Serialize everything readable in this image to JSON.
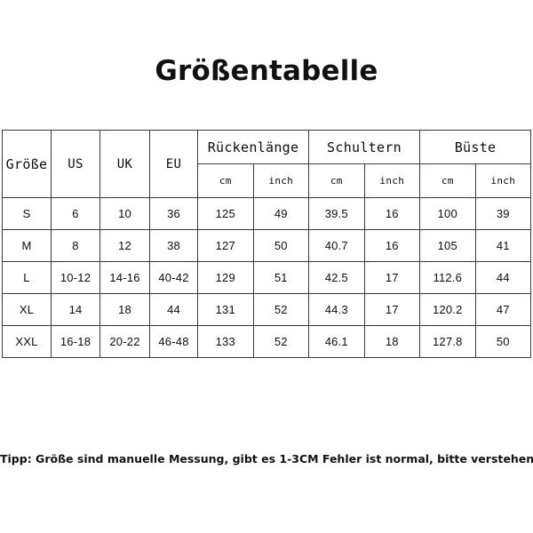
{
  "document": {
    "title": "Größentabelle",
    "note": "Tipp: Größe sind manuelle Messung, gibt es 1-3CM Fehler ist normal, bitte verstehen."
  },
  "table": {
    "headers": {
      "size": "Größe",
      "us": "US",
      "uk": "UK",
      "eu": "EU",
      "groups": [
        {
          "label": "Rückenlänge",
          "sub": [
            "cm",
            "inch"
          ]
        },
        {
          "label": "Schultern",
          "sub": [
            "cm",
            "inch"
          ]
        },
        {
          "label": "Büste",
          "sub": [
            "cm",
            "inch"
          ]
        }
      ]
    },
    "rows": [
      {
        "size": "S",
        "us": "6",
        "uk": "10",
        "eu": "36",
        "back_cm": "125",
        "back_inch": "49",
        "shoulder_cm": "39.5",
        "shoulder_inch": "16",
        "bust_cm": "100",
        "bust_inch": "39"
      },
      {
        "size": "M",
        "us": "8",
        "uk": "12",
        "eu": "38",
        "back_cm": "127",
        "back_inch": "50",
        "shoulder_cm": "40.7",
        "shoulder_inch": "16",
        "bust_cm": "105",
        "bust_inch": "41"
      },
      {
        "size": "L",
        "us": "10-12",
        "uk": "14-16",
        "eu": "40-42",
        "back_cm": "129",
        "back_inch": "51",
        "shoulder_cm": "42.5",
        "shoulder_inch": "17",
        "bust_cm": "112.6",
        "bust_inch": "44"
      },
      {
        "size": "XL",
        "us": "14",
        "uk": "18",
        "eu": "44",
        "back_cm": "131",
        "back_inch": "52",
        "shoulder_cm": "44.3",
        "shoulder_inch": "17",
        "bust_cm": "120.2",
        "bust_inch": "47"
      },
      {
        "size": "XXL",
        "us": "16-18",
        "uk": "20-22",
        "eu": "46-48",
        "back_cm": "133",
        "back_inch": "52",
        "shoulder_cm": "46.1",
        "shoulder_inch": "18",
        "bust_cm": "127.8",
        "bust_inch": "50"
      }
    ]
  },
  "colors": {
    "background": "#ffffff",
    "text": "#111111",
    "border": "#3a3a3a"
  }
}
